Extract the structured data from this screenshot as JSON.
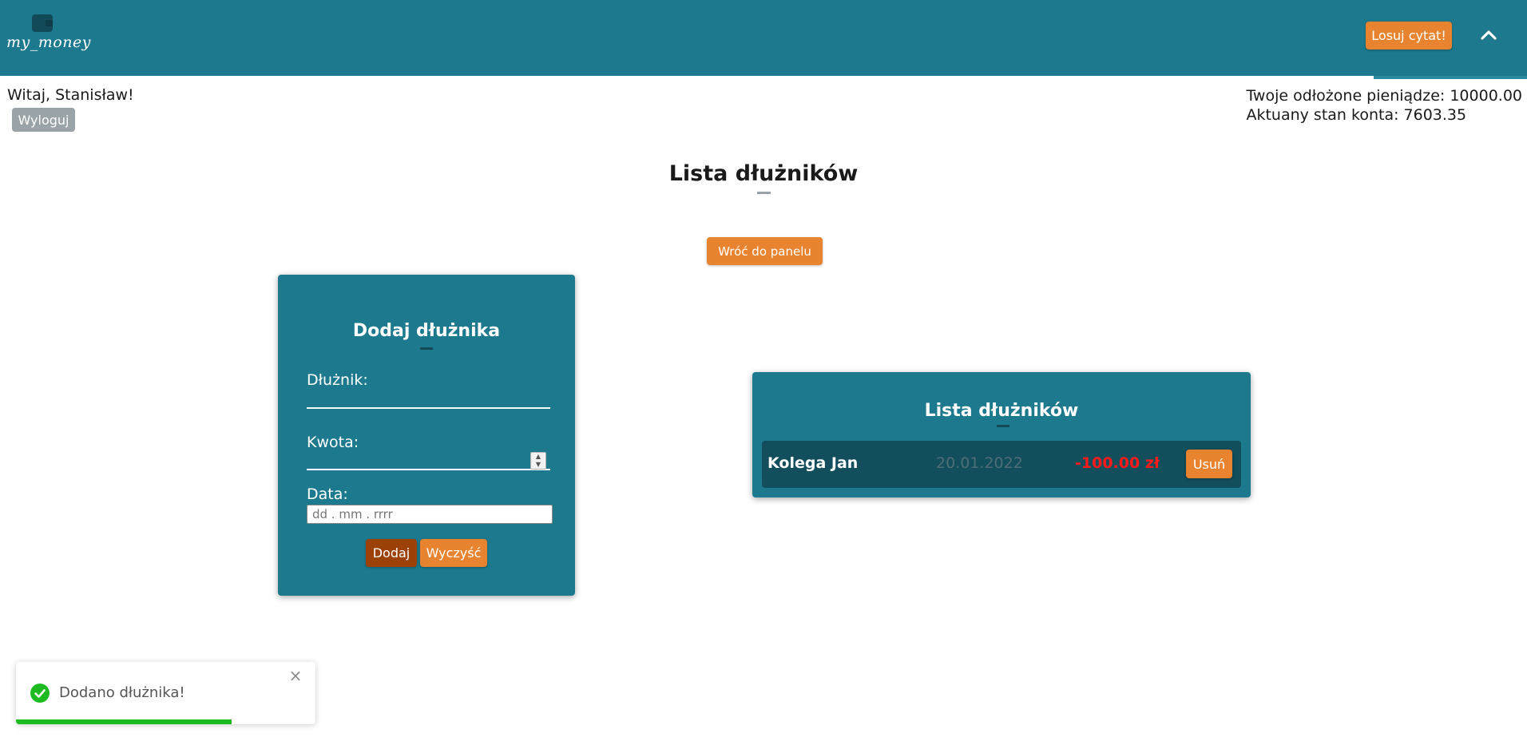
{
  "header": {
    "logo_text": "my_money",
    "quote_button": "Losuj cytat!"
  },
  "user": {
    "welcome": "Witaj, Stanisław!",
    "logout": "Wyloguj",
    "saved_money": "Twoje odłożone pieniądze: 10000.00",
    "balance": "Aktuany stan konta: 7603.35"
  },
  "page": {
    "title": "Lista dłużników",
    "back_button": "Wróć do panelu"
  },
  "add_form": {
    "title": "Dodaj dłużnika",
    "debtor_label": "Dłużnik:",
    "debtor_value": "",
    "amount_label": "Kwota:",
    "amount_value": "",
    "date_label": "Data:",
    "date_placeholder": "dd . mm . rrrr",
    "add_button": "Dodaj",
    "clear_button": "Wyczyść"
  },
  "debtor_list": {
    "title": "Lista dłużników",
    "rows": [
      {
        "name": "Kolega Jan",
        "date": "20.01.2022",
        "amount": "-100.00 zł",
        "delete": "Usuń"
      }
    ]
  },
  "toast": {
    "message": "Dodano dłużnika!",
    "close": "×",
    "progress": 0.72
  },
  "colors": {
    "header": "#1d7a8e",
    "accent": "#e8832f",
    "add_button": "#9c4208",
    "row": "#134e5c",
    "negative": "#ff1a1a",
    "success": "#1dbb21"
  }
}
